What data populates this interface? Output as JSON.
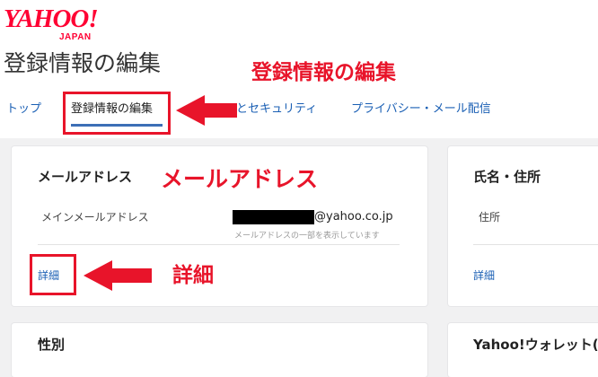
{
  "logo": {
    "main": "YAHOO!",
    "sub": "JAPAN"
  },
  "page_title": "登録情報の編集",
  "annotations": {
    "title": "登録情報の編集",
    "mail": "メールアドレス",
    "detail": "詳細"
  },
  "tabs": [
    {
      "label": "トップ"
    },
    {
      "label": "登録情報の編集",
      "active": true
    },
    {
      "label": "とセキュリティ"
    },
    {
      "label": "プライバシー・メール配信"
    }
  ],
  "email_card": {
    "heading": "メールアドレス",
    "row_label": "メインメールアドレス",
    "email_domain": "@yahoo.co.jp",
    "note": "メールアドレスの一部を表示しています",
    "detail_link": "詳細"
  },
  "name_card": {
    "heading": "氏名・住所",
    "row_label": "住所",
    "detail_link": "詳細"
  },
  "gender_card": {
    "heading": "性別"
  },
  "wallet_card": {
    "heading": "Yahoo!ウォレット("
  },
  "colors": {
    "accent_red": "#e8142a",
    "link_blue": "#1a5fb4",
    "brand_red": "#ff0033"
  }
}
